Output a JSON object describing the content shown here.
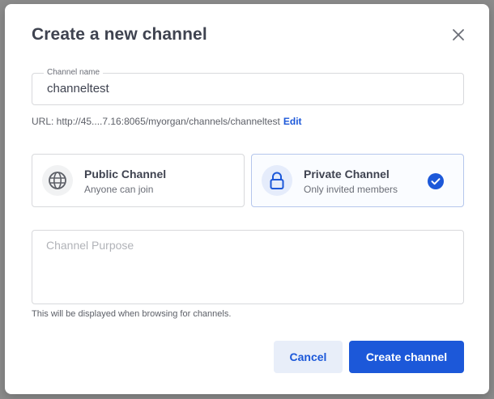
{
  "modal": {
    "title": "Create a new channel",
    "close_icon": "close-icon"
  },
  "name_field": {
    "label": "Channel name",
    "value": "channeltest"
  },
  "url": {
    "text": "URL: http://45....7.16:8065/myorgan/channels/channeltest",
    "edit_label": "Edit"
  },
  "channel_types": {
    "public": {
      "title": "Public Channel",
      "subtitle": "Anyone can join",
      "icon": "globe-icon",
      "selected": false
    },
    "private": {
      "title": "Private Channel",
      "subtitle": "Only invited members",
      "icon": "lock-icon",
      "selected": true
    }
  },
  "purpose": {
    "placeholder": "Channel Purpose",
    "value": "",
    "help": "This will be displayed when browsing for channels."
  },
  "buttons": {
    "cancel_label": "Cancel",
    "create_label": "Create channel"
  },
  "colors": {
    "accent": "#1c58d9",
    "text": "#3f4350",
    "backdrop": "#8b8b8b"
  }
}
